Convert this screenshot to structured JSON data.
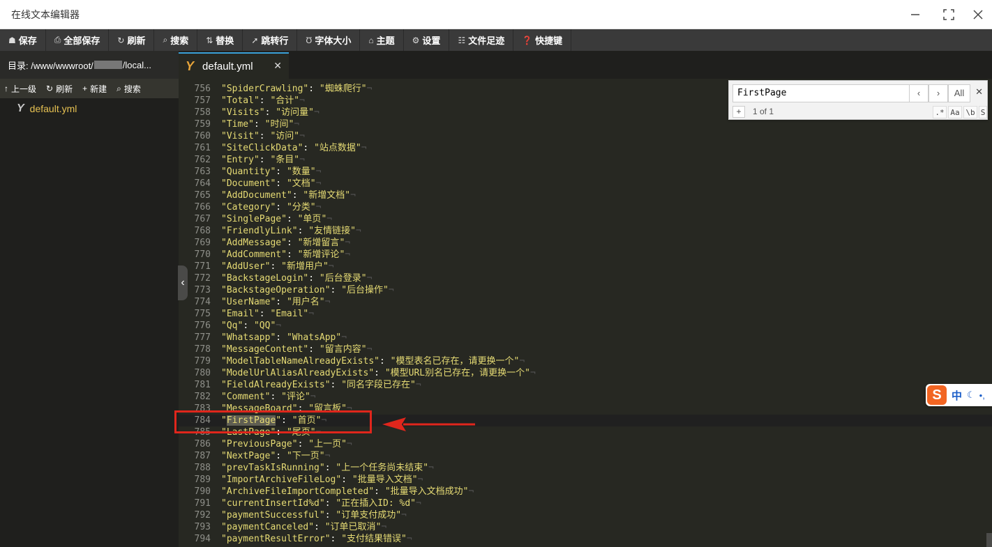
{
  "window": {
    "title": "在线文本编辑器",
    "minimize_icon": "minimize-icon",
    "maximize_icon": "maximize-icon",
    "close_icon": "close-icon"
  },
  "toolbar": [
    {
      "label": "保存",
      "icon": "save-icon",
      "glyph": "☗"
    },
    {
      "label": "全部保存",
      "icon": "save-all-icon",
      "glyph": "⎙"
    },
    {
      "label": "刷新",
      "icon": "refresh-icon",
      "glyph": "↻"
    },
    {
      "label": "搜索",
      "icon": "search-icon",
      "glyph": "⌕"
    },
    {
      "label": "替换",
      "icon": "replace-icon",
      "glyph": "⇅"
    },
    {
      "label": "跳转行",
      "icon": "goto-line-icon",
      "glyph": "➚"
    },
    {
      "label": "字体大小",
      "icon": "font-size-icon",
      "glyph": "Ʊ"
    },
    {
      "label": "主题",
      "icon": "theme-icon",
      "glyph": "⌂"
    },
    {
      "label": "设置",
      "icon": "settings-icon",
      "glyph": "⚙"
    },
    {
      "label": "文件足迹",
      "icon": "history-icon",
      "glyph": "☷"
    },
    {
      "label": "快捷键",
      "icon": "help-icon",
      "glyph": "❓"
    }
  ],
  "sidebar": {
    "dir_prefix": "目录: /www/wwwroot/",
    "dir_suffix": "/local...",
    "actions": [
      {
        "label": "上一级",
        "icon": "up-icon",
        "glyph": "↑"
      },
      {
        "label": "刷新",
        "icon": "refresh-icon",
        "glyph": "↻"
      },
      {
        "label": "新建",
        "icon": "plus-icon",
        "glyph": "+"
      },
      {
        "label": "搜索",
        "icon": "search-icon",
        "glyph": "⌕"
      }
    ],
    "file": "default.yml"
  },
  "tab": {
    "label": "default.yml",
    "close": "✕"
  },
  "editor": {
    "active_line": 784,
    "lines": [
      {
        "n": "756",
        "key": "SpiderCrawling",
        "val": "蜘蛛爬行"
      },
      {
        "n": "757",
        "key": "Total",
        "val": "合计"
      },
      {
        "n": "758",
        "key": "Visits",
        "val": "访问量"
      },
      {
        "n": "759",
        "key": "Time",
        "val": "时间"
      },
      {
        "n": "760",
        "key": "Visit",
        "val": "访问"
      },
      {
        "n": "761",
        "key": "SiteClickData",
        "val": "站点数据"
      },
      {
        "n": "762",
        "key": "Entry",
        "val": "条目"
      },
      {
        "n": "763",
        "key": "Quantity",
        "val": "数量"
      },
      {
        "n": "764",
        "key": "Document",
        "val": "文档"
      },
      {
        "n": "765",
        "key": "AddDocument",
        "val": "新增文档"
      },
      {
        "n": "766",
        "key": "Category",
        "val": "分类"
      },
      {
        "n": "767",
        "key": "SinglePage",
        "val": "单页"
      },
      {
        "n": "768",
        "key": "FriendlyLink",
        "val": "友情链接"
      },
      {
        "n": "769",
        "key": "AddMessage",
        "val": "新增留言"
      },
      {
        "n": "770",
        "key": "AddComment",
        "val": "新增评论"
      },
      {
        "n": "771",
        "key": "AddUser",
        "val": "新增用户"
      },
      {
        "n": "772",
        "key": "BackstageLogin",
        "val": "后台登录"
      },
      {
        "n": "773",
        "key": "BackstageOperation",
        "val": "后台操作"
      },
      {
        "n": "774",
        "key": "UserName",
        "val": "用户名"
      },
      {
        "n": "775",
        "key": "Email",
        "val": "Email"
      },
      {
        "n": "776",
        "key": "Qq",
        "val": "QQ"
      },
      {
        "n": "777",
        "key": "Whatsapp",
        "val": "WhatsApp"
      },
      {
        "n": "778",
        "key": "MessageContent",
        "val": "留言内容"
      },
      {
        "n": "779",
        "key": "ModelTableNameAlreadyExists",
        "val": "模型表名已存在，请更换一个"
      },
      {
        "n": "780",
        "key": "ModelUrlAliasAlreadyExists",
        "val": "模型URL别名已存在，请更换一个"
      },
      {
        "n": "781",
        "key": "FieldAlreadyExists",
        "val": "同名字段已存在"
      },
      {
        "n": "782",
        "key": "Comment",
        "val": "评论"
      },
      {
        "n": "783",
        "key": "MessageBoard",
        "val": "留言板"
      },
      {
        "n": "784",
        "key": "FirstPage",
        "val": "首页"
      },
      {
        "n": "785",
        "key": "LastPage",
        "val": "尾页"
      },
      {
        "n": "786",
        "key": "PreviousPage",
        "val": "上一页"
      },
      {
        "n": "787",
        "key": "NextPage",
        "val": "下一页"
      },
      {
        "n": "788",
        "key": "prevTaskIsRunning",
        "val": "上一个任务尚未结束"
      },
      {
        "n": "789",
        "key": "ImportArchiveFileLog",
        "val": "批量导入文档"
      },
      {
        "n": "790",
        "key": "ArchiveFileImportCompleted",
        "val": "批量导入文档成功"
      },
      {
        "n": "791",
        "key": "currentInsertId%d",
        "val": "正在插入ID: %d"
      },
      {
        "n": "792",
        "key": "paymentSuccessful",
        "val": "订单支付成功"
      },
      {
        "n": "793",
        "key": "paymentCanceled",
        "val": "订单已取消"
      },
      {
        "n": "794",
        "key": "paymentResultError",
        "val": "支付结果错误"
      }
    ]
  },
  "search": {
    "value": "FirstPage",
    "prev": "‹",
    "next": "›",
    "all": "All",
    "close": "✕",
    "plus": "+",
    "count": "1 of 1",
    "opts": [
      ".*",
      "Aa",
      "\\b",
      "S"
    ]
  },
  "ime": {
    "logo": "S",
    "lang": "中",
    "moon": "☾",
    "dot": "•,"
  },
  "colors": {
    "editor_bg": "#272822",
    "string": "#e6db74",
    "annotation": "#e0261c",
    "tab_accent": "#3aa0d8",
    "file_label": "#e6c152"
  }
}
